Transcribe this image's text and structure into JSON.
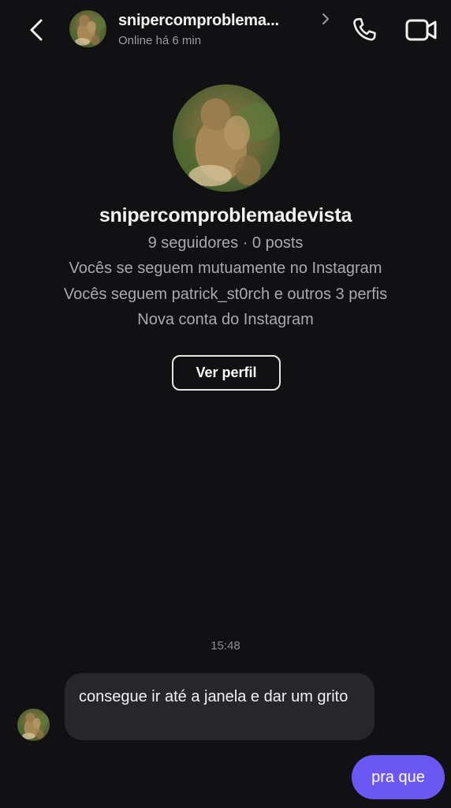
{
  "header": {
    "username": "snipercomproblema...",
    "status": "Online há 6 min"
  },
  "profile": {
    "name": "snipercomproblemadevista",
    "stats": "9 seguidores · 0 posts",
    "mutual": "Vocês se seguem mutuamente no Instagram",
    "following": "Vocês seguem patrick_st0rch e outros 3 perfis",
    "new_account": "Nova conta do Instagram",
    "view_profile_label": "Ver perfil"
  },
  "conversation": {
    "timestamp": "15:48",
    "messages": [
      {
        "from": "them",
        "text": "consegue ir até a janela e dar um grito"
      },
      {
        "from": "me",
        "text": "pra que"
      }
    ]
  },
  "colors": {
    "background": "#111114",
    "incoming_bubble": "#26262b",
    "outgoing_bubble": "#6b57f2"
  },
  "icons": [
    "back-arrow-icon",
    "chevron-right-icon",
    "phone-icon",
    "video-camera-icon"
  ]
}
